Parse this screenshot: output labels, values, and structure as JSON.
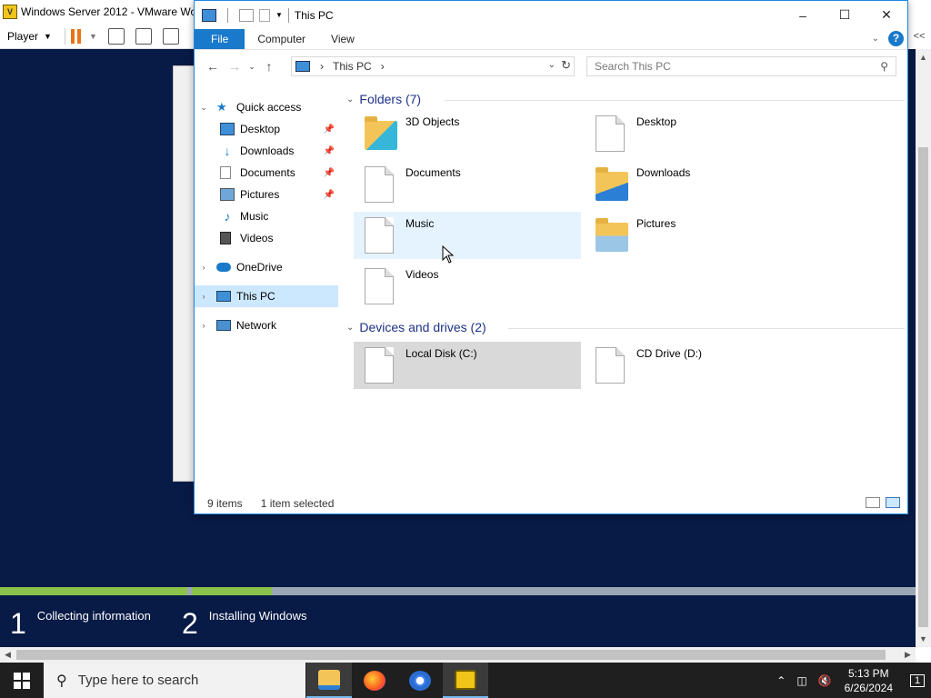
{
  "vmware": {
    "title": "Windows Server 2012 - VMware Wor",
    "player_label": "Player",
    "collapse_label": "<<"
  },
  "guest": {
    "steps": [
      {
        "num": "1",
        "label": "Collecting information"
      },
      {
        "num": "2",
        "label": "Installing Windows"
      }
    ],
    "progress_fraction": 0.3
  },
  "explorer": {
    "title": "This PC",
    "ribbon": {
      "file": "File",
      "computer": "Computer",
      "view": "View",
      "help": "?"
    },
    "address_crumb": "This PC",
    "search_placeholder": "Search This PC",
    "nav": {
      "quick_access": "Quick access",
      "desktop": "Desktop",
      "downloads": "Downloads",
      "documents": "Documents",
      "pictures": "Pictures",
      "music": "Music",
      "videos": "Videos",
      "onedrive": "OneDrive",
      "this_pc": "This PC",
      "network": "Network"
    },
    "folders_header": "Folders (7)",
    "folders": {
      "objects3d": "3D Objects",
      "desktop": "Desktop",
      "documents": "Documents",
      "downloads": "Downloads",
      "music": "Music",
      "pictures": "Pictures",
      "videos": "Videos"
    },
    "drives_header": "Devices and drives (2)",
    "drives": {
      "c": "Local Disk (C:)",
      "d": "CD Drive (D:)"
    },
    "status": {
      "items": "9 items",
      "selected": "1 item selected"
    }
  },
  "taskbar": {
    "search_placeholder": "Type here to search",
    "time": "5:13 PM",
    "date": "6/26/2024",
    "notification_count": "1"
  },
  "colors": {
    "guest_bg": "#081a46",
    "progress": "#8bc34a",
    "accent": "#1979ca",
    "header_text": "#1e3287"
  }
}
